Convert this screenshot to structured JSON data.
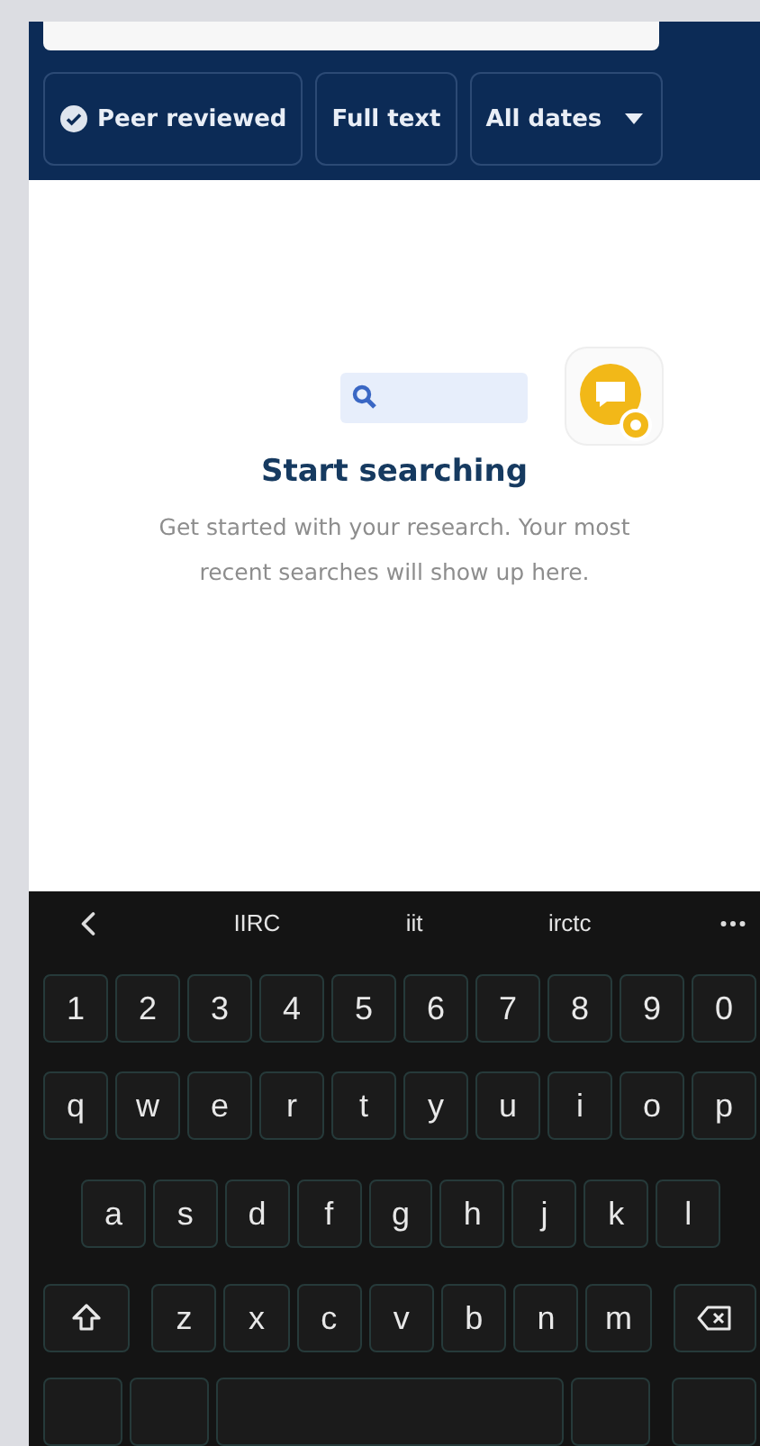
{
  "filters": [
    {
      "label": "Peer reviewed",
      "kind": "verified"
    },
    {
      "label": "Full text",
      "kind": "plain"
    },
    {
      "label": "All dates",
      "kind": "dropdown"
    }
  ],
  "empty_state": {
    "title": "Start searching",
    "message": "Get started with your research. Your most recent searches will show up here."
  },
  "keyboard": {
    "suggestions": [
      "IIRC",
      "iit",
      "irctc"
    ],
    "rows": [
      [
        "1",
        "2",
        "3",
        "4",
        "5",
        "6",
        "7",
        "8",
        "9",
        "0"
      ],
      [
        "q",
        "w",
        "e",
        "r",
        "t",
        "y",
        "u",
        "i",
        "o",
        "p"
      ],
      [
        "a",
        "s",
        "d",
        "f",
        "g",
        "h",
        "j",
        "k",
        "l"
      ],
      [
        {
          "kind": "shift"
        },
        "z",
        "x",
        "c",
        "v",
        "b",
        "n",
        "m",
        {
          "kind": "backspace"
        }
      ],
      [
        {
          "kind": "blank"
        },
        {
          "kind": "blank"
        },
        {
          "kind": "space"
        },
        {
          "kind": "blank"
        },
        {
          "kind": "enter"
        }
      ]
    ]
  }
}
